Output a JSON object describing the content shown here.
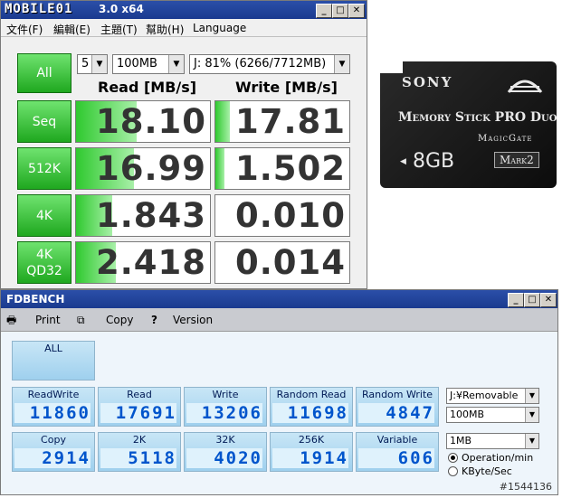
{
  "cdm": {
    "title_logo": "MOBILE01",
    "title_suffix": "3.0 x64",
    "menu": [
      "文件(F)",
      "編輯(E)",
      "主題(T)",
      "幫助(H)",
      "Language"
    ],
    "runs": "5",
    "size": "100MB",
    "drive": "J: 81% (6266/7712MB)",
    "all_label": "All",
    "read_header": "Read [MB/s]",
    "write_header": "Write [MB/s]",
    "rows": [
      {
        "label": "Seq",
        "read": "18.10",
        "write": "17.81",
        "read_fill": 0.45,
        "write_fill": 0.11
      },
      {
        "label": "512K",
        "read": "16.99",
        "write": "1.502",
        "read_fill": 0.43,
        "write_fill": 0.07
      },
      {
        "label": "4K",
        "read": "1.843",
        "write": "0.010",
        "read_fill": 0.27,
        "write_fill": 0.0
      },
      {
        "label": "4K\nQD32",
        "read": "2.418",
        "write": "0.014",
        "read_fill": 0.3,
        "write_fill": 0.0
      }
    ]
  },
  "card": {
    "brand": "SONY",
    "product": "Memory Stick PRO Duo",
    "tech": "MagicGate",
    "capacity": "8GB",
    "mark": "Mark2"
  },
  "fdbench": {
    "title": "FDBENCH",
    "toolbar": {
      "print": "Print",
      "copy": "Copy",
      "version": "Version"
    },
    "all_label": "ALL",
    "row1": [
      {
        "label": "ReadWrite",
        "value": "11860"
      },
      {
        "label": "Read",
        "value": "17691"
      },
      {
        "label": "Write",
        "value": "13206"
      },
      {
        "label": "Random Read",
        "value": "11698"
      },
      {
        "label": "Random Write",
        "value": "4847"
      }
    ],
    "row2": [
      {
        "label": "Copy",
        "value": "2914"
      },
      {
        "label": "2K",
        "value": "5118"
      },
      {
        "label": "32K",
        "value": "4020"
      },
      {
        "label": "256K",
        "value": "1914"
      },
      {
        "label": "Variable",
        "value": "606"
      }
    ],
    "drive_select": "J:¥Removable",
    "size_select": "100MB",
    "block_select": "1MB",
    "radio_ops": "Operation/min",
    "radio_kbyte": "KByte/Sec",
    "watermark": "#1544136"
  },
  "colors": {
    "title_bar": "#1a3a8f",
    "green": "#2fc92f",
    "lcd_blue": "#0055cc"
  }
}
